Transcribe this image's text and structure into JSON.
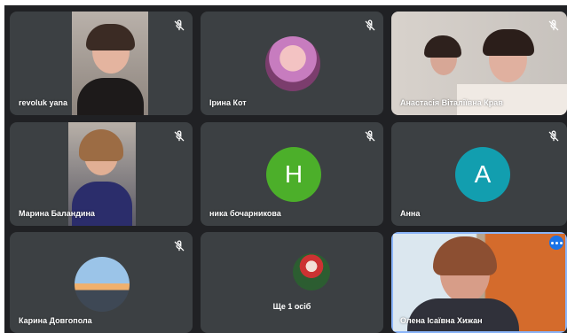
{
  "participants": [
    {
      "name": "revoluk yana",
      "muted": true,
      "type": "video"
    },
    {
      "name": "Ірина Кот",
      "muted": true,
      "type": "photo-avatar"
    },
    {
      "name": "Анастасія Віталіївна Крав",
      "muted": true,
      "type": "video"
    },
    {
      "name": "Марина Баландина",
      "muted": true,
      "type": "video"
    },
    {
      "name": "ника бочарникова",
      "muted": true,
      "type": "letter-avatar",
      "initial": "Н",
      "color": "#4caf2a"
    },
    {
      "name": "Анна",
      "muted": true,
      "type": "letter-avatar",
      "initial": "А",
      "color": "#129eaf"
    },
    {
      "name": "Карина Довгопола",
      "muted": true,
      "type": "photo-avatar"
    },
    {
      "name": "Олена Ісаївна Хижан",
      "muted": false,
      "type": "video",
      "active": true
    }
  ],
  "overflow": {
    "label": "Ще 1 осіб"
  },
  "colors": {
    "tile": "#3c4043",
    "background": "#202124",
    "active_border": "#8ab4f8",
    "menu": "#1a73e8"
  },
  "icons": {
    "mute": "mic-off-icon",
    "menu": "more-options-icon"
  }
}
